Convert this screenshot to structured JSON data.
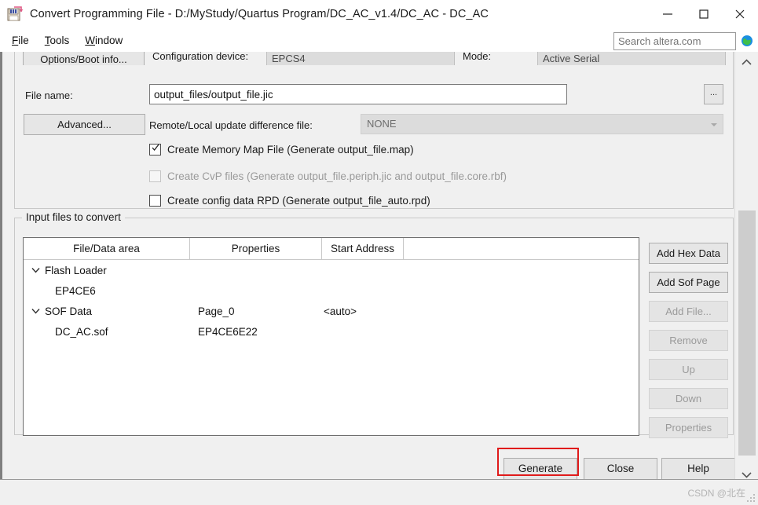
{
  "window": {
    "title": "Convert Programming File - D:/MyStudy/Quartus Program/DC_AC_v1.4/DC_AC - DC_AC",
    "icon": "convert-programming-file-icon",
    "minimize_label": "—",
    "maximize_label": "□",
    "close_label": "✕"
  },
  "menubar": {
    "items": [
      {
        "label": "File",
        "mnemonic": "F",
        "rest": "ile"
      },
      {
        "label": "Tools",
        "mnemonic": "T",
        "rest": "ools"
      },
      {
        "label": "Window",
        "mnemonic": "W",
        "rest": "indow"
      }
    ]
  },
  "search": {
    "placeholder": "Search altera.com",
    "value": "",
    "icon": "globe-icon"
  },
  "clipped_row": {
    "options_boot_info_label": "Options/Boot info...",
    "configuration_device_label": "Configuration device:",
    "configuration_device_value": "EPCS4",
    "mode_label": "Mode:",
    "mode_value": "Active Serial"
  },
  "file_section": {
    "file_name_label": "File name:",
    "file_name_value": "output_files/output_file.jic",
    "browse_label": "...",
    "advanced_label": "Advanced...",
    "remote_local_label": "Remote/Local update difference file:",
    "remote_local_value": "NONE"
  },
  "checkboxes": [
    {
      "label": "Create Memory Map File (Generate output_file.map)",
      "checked": true,
      "disabled": false
    },
    {
      "label": "Create CvP files (Generate output_file.periph.jic and output_file.core.rbf)",
      "checked": false,
      "disabled": true
    },
    {
      "label": "Create config data RPD (Generate output_file_auto.rpd)",
      "checked": false,
      "disabled": false
    }
  ],
  "input_files": {
    "group_label": "Input files to convert",
    "columns": [
      "File/Data area",
      "Properties",
      "Start Address",
      ""
    ],
    "rows": [
      {
        "name": "Flash Loader",
        "properties": "",
        "start_address": "",
        "expandable": true,
        "indent": false
      },
      {
        "name": "EP4CE6",
        "properties": "",
        "start_address": "",
        "expandable": false,
        "indent": true
      },
      {
        "name": "SOF Data",
        "properties": "Page_0",
        "start_address": "<auto>",
        "expandable": true,
        "indent": false
      },
      {
        "name": "DC_AC.sof",
        "properties": "EP4CE6E22",
        "start_address": "",
        "expandable": false,
        "indent": true
      }
    ],
    "side_buttons": [
      {
        "label": "Add Hex Data",
        "disabled": false
      },
      {
        "label": "Add Sof Page",
        "disabled": false
      },
      {
        "label": "Add File...",
        "disabled": true
      },
      {
        "label": "Remove",
        "disabled": true
      },
      {
        "label": "Up",
        "disabled": true
      },
      {
        "label": "Down",
        "disabled": true
      },
      {
        "label": "Properties",
        "disabled": true
      }
    ]
  },
  "bottom_buttons": {
    "generate": "Generate",
    "close": "Close",
    "help": "Help"
  },
  "highlight": {
    "target": "generate",
    "color": "#e01b1b"
  },
  "watermark": {
    "text": "CSDN @北在"
  },
  "colors": {
    "panel_bg": "#f0f0f0",
    "button_face": "#e6e6e6",
    "disabled_text": "#9a9a9a",
    "table_bg": "#ffffff",
    "accent_red": "#e01b1b",
    "scroll_thumb": "#cdcdcd"
  }
}
